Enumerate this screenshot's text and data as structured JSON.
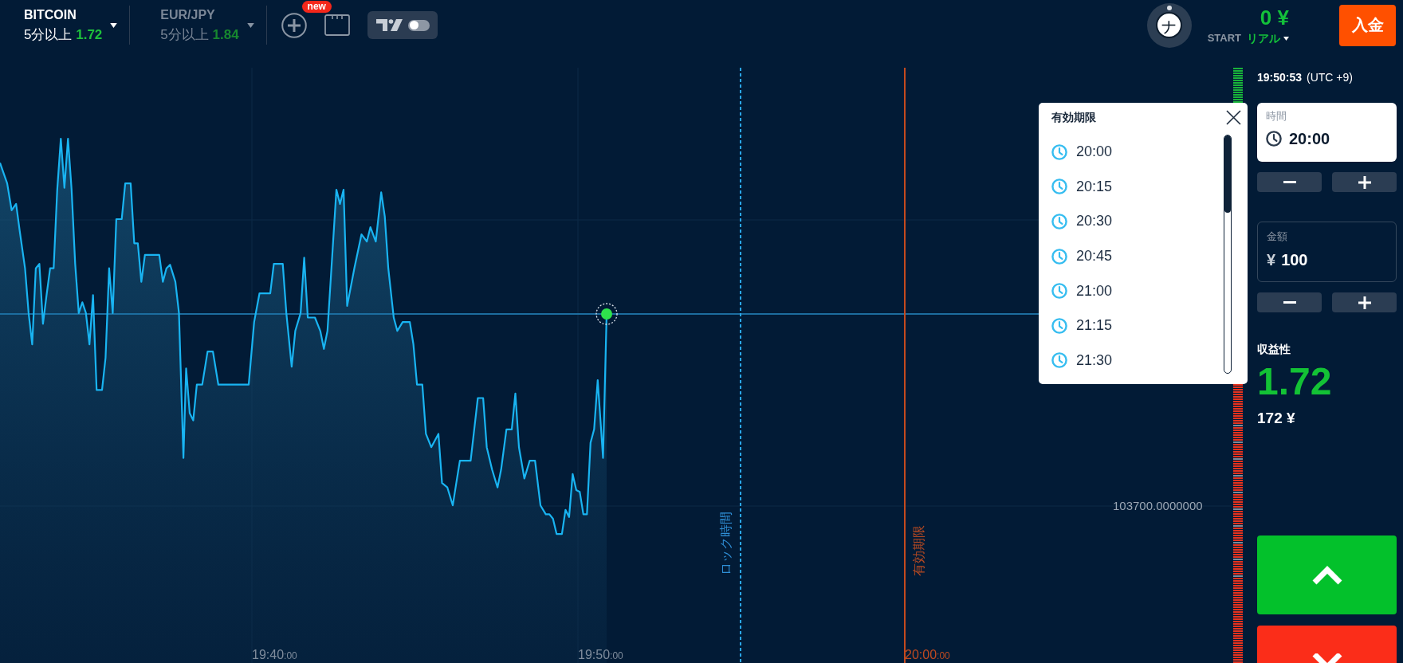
{
  "header": {
    "assets": [
      {
        "name": "BITCOIN",
        "duration": "5分以上",
        "payout": "1.72",
        "selected": true
      },
      {
        "name": "EUR/JPY",
        "duration": "5分以上",
        "payout": "1.84",
        "selected": false
      }
    ],
    "new_badge": "new",
    "chart_toggle": {
      "on": false
    },
    "avatar": {
      "initial": "ナ"
    },
    "balance": {
      "amount": "0 ¥",
      "mode_label": "START",
      "account_type": "リアル"
    },
    "deposit_button": "入金"
  },
  "chart": {
    "price_label": "103700.0000000",
    "x_axis_labels": [
      {
        "time": "19:40",
        "seconds": ":00"
      },
      {
        "time": "19:50",
        "seconds": ":00"
      }
    ],
    "lock_line": {
      "label": "ロック時間"
    },
    "expiry_line": {
      "label": "有効期限",
      "time": "20:00",
      "seconds": ":00"
    }
  },
  "expiry_dropdown": {
    "title": "有効期限",
    "options": [
      "20:00",
      "20:15",
      "20:30",
      "20:45",
      "21:00",
      "21:15",
      "21:30"
    ]
  },
  "trade_panel": {
    "server_time": "19:50:53",
    "timezone": "(UTC +9)",
    "time_field": {
      "label": "時間",
      "value": "20:00"
    },
    "amount_field": {
      "label": "金額",
      "currency": "¥",
      "value": "100"
    },
    "payout_label": "収益性",
    "payout_rate": "1.72",
    "payout_amount": "172 ¥"
  }
}
